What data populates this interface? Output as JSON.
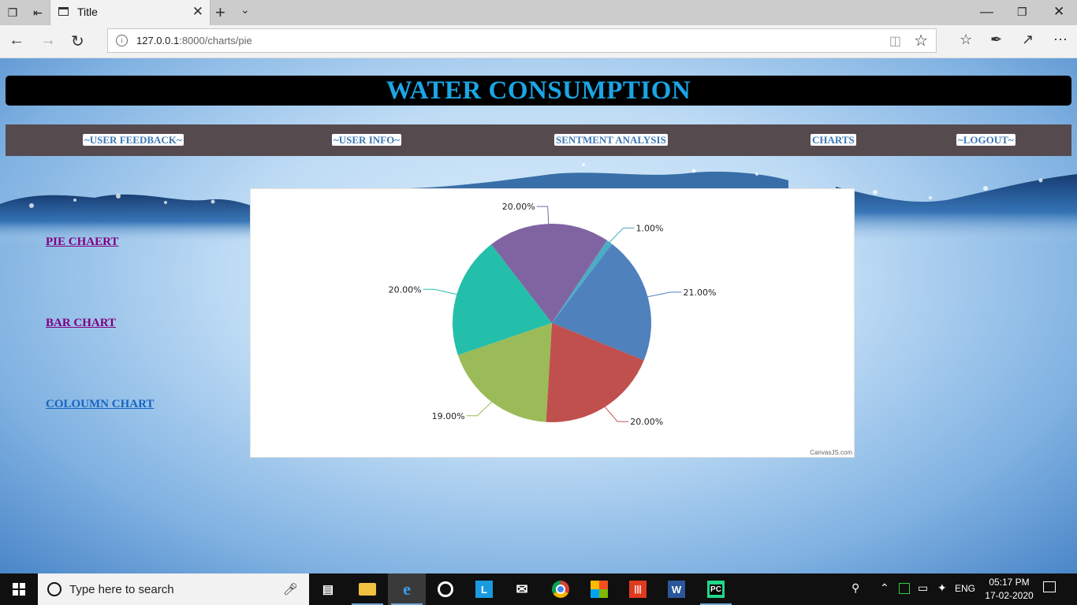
{
  "browser": {
    "tab_title": "Title",
    "url_host": "127.0.0.1",
    "url_path": ":8000/charts/pie"
  },
  "header": {
    "title": "WATER CONSUMPTION"
  },
  "nav": {
    "items": [
      "~USER FEEDBACK~",
      "~USER INFO~",
      "SENTMENT ANALYSIS",
      "CHARTS",
      "~LOGOUT~"
    ]
  },
  "sidebar": {
    "links": [
      "PIE CHAERT",
      "BAR CHART",
      "COLOUMN CHART"
    ]
  },
  "chart": {
    "credit": "CanvasJS.com"
  },
  "chart_data": {
    "type": "pie",
    "values": [
      21,
      20,
      19,
      20,
      20,
      1
    ],
    "labels": [
      "21.00%",
      "20.00%",
      "19.00%",
      "20.00%",
      "20.00%",
      "1.00%"
    ],
    "colors": [
      "#4f81bc",
      "#c0504e",
      "#9bbb58",
      "#23bfaa",
      "#8064a1",
      "#4aacc5"
    ]
  },
  "taskbar": {
    "search_placeholder": "Type here to search",
    "language": "ENG",
    "time": "05:17 PM",
    "date": "17-02-2020"
  },
  "colors": {
    "banner_text": "#1aa6e6",
    "nav_bg": "#554a4e",
    "link_visited": "#800080",
    "link": "#1565c0"
  }
}
